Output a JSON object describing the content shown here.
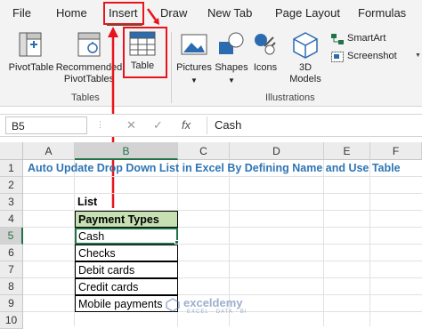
{
  "tabs": [
    "File",
    "Home",
    "Insert",
    "Draw",
    "New Tab",
    "Page Layout",
    "Formulas"
  ],
  "ribbon": {
    "pivot_table": "PivotTable",
    "recommended": "Recommended PivotTables",
    "table": "Table",
    "pictures": "Pictures",
    "shapes": "Shapes",
    "icons": "Icons",
    "models": "3D Models",
    "smartart": "SmartArt",
    "screenshot": "Screenshot",
    "group_tables": "Tables",
    "group_illustrations": "Illustrations"
  },
  "formula_bar": {
    "name_box": "B5",
    "value": "Cash",
    "cancel": "✕",
    "enter": "✓",
    "fx": "fx"
  },
  "columns": [
    "A",
    "B",
    "C",
    "D",
    "E",
    "F"
  ],
  "rows": [
    "1",
    "2",
    "3",
    "4",
    "5",
    "6",
    "7",
    "8",
    "9",
    "10"
  ],
  "sheet": {
    "title": "Auto Update Drop Down List in Excel By Defining Name and Use Table",
    "list_label": "List",
    "header": "Payment Types",
    "items": [
      "Cash",
      "Checks",
      "Debit cards",
      "Credit cards",
      "Mobile payments"
    ]
  },
  "watermark": "exceldemy",
  "watermark_sub": "EXCEL · DATA · BI",
  "colors": {
    "accent": "#217346",
    "highlight": "#e8141c",
    "header_fill": "#c6e0b4",
    "title": "#2f75b5"
  }
}
